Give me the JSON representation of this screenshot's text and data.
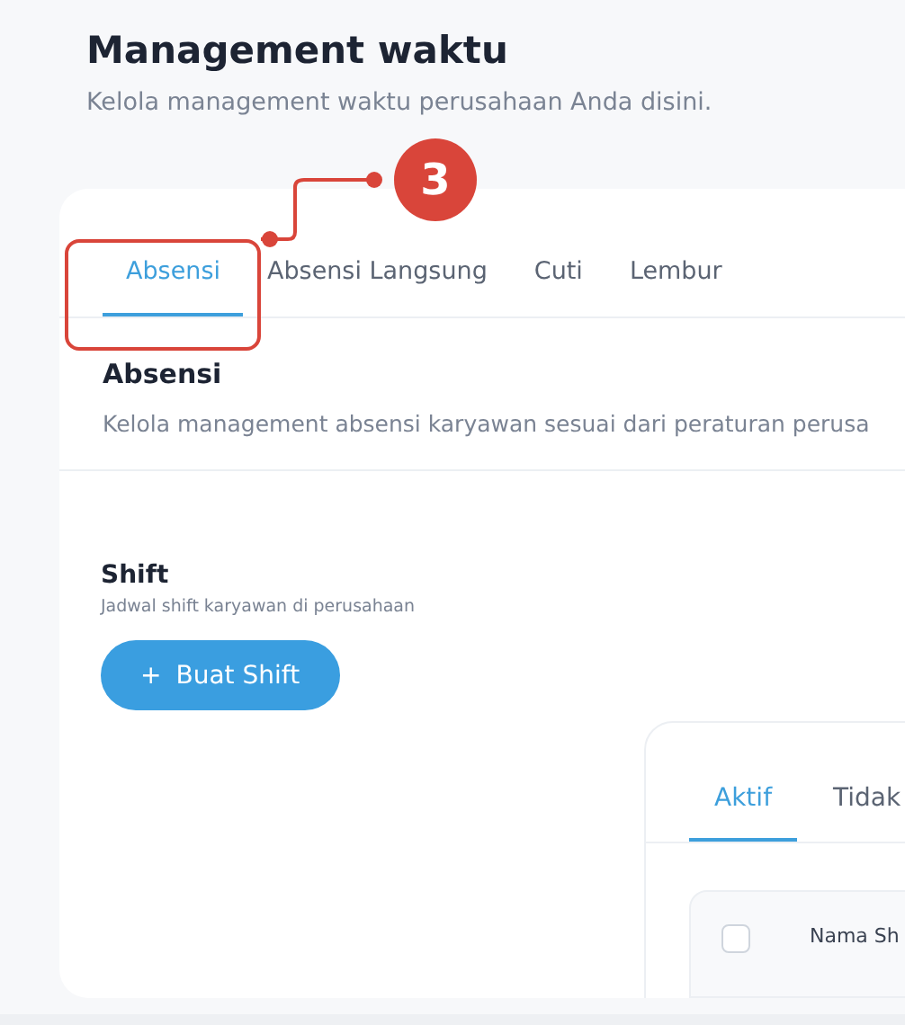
{
  "header": {
    "title": "Management waktu",
    "subtitle": "Kelola management waktu perusahaan Anda disini."
  },
  "tabs": [
    {
      "label": "Absensi",
      "selected": true
    },
    {
      "label": "Absensi Langsung",
      "selected": false
    },
    {
      "label": "Cuti",
      "selected": false
    },
    {
      "label": "Lembur",
      "selected": false
    }
  ],
  "section": {
    "title": "Absensi",
    "description": "Kelola management absensi karyawan sesuai dari peraturan perusa"
  },
  "shift": {
    "title": "Shift",
    "description": "Jadwal shift karyawan di perusahaan",
    "button": {
      "icon": "+",
      "label": "Buat Shift"
    }
  },
  "shift_panel": {
    "tabs": [
      {
        "label": "Aktif",
        "selected": true
      },
      {
        "label": "Tidak",
        "selected": false
      }
    ],
    "table": {
      "select_all": {
        "checked": false
      },
      "columns": [
        "Nama Sh"
      ]
    }
  },
  "annotation": {
    "number": "3"
  }
}
